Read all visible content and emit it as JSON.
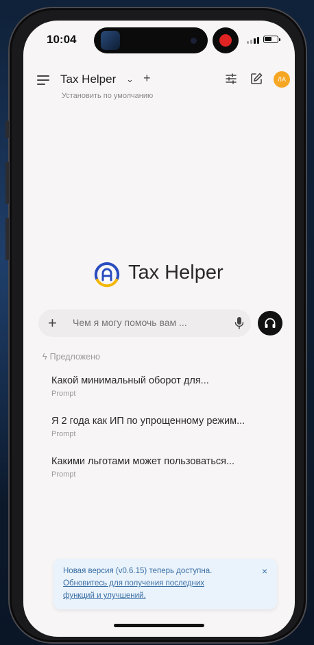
{
  "status_bar": {
    "time": "10:04"
  },
  "header": {
    "title": "Tax Helper",
    "chevron": "⌄",
    "new_model": "+",
    "set_default": "Установить по умолчанию",
    "avatar_initials": "ЛА"
  },
  "brand": {
    "name": "Tax Helper"
  },
  "chat_input": {
    "add": "+",
    "placeholder": "Чем я могу помочь вам ..."
  },
  "suggestions": {
    "heading": "Предложено",
    "items": [
      {
        "title": "Какой минимальный оборот для...",
        "subtitle": "Prompt"
      },
      {
        "title": "Я 2 года как ИП по упрощенному режим...",
        "subtitle": "Prompt"
      },
      {
        "title": "Какими льготами может пользоваться...",
        "subtitle": "Prompt"
      }
    ]
  },
  "toast": {
    "line1": "Новая версия (v0.6.15) теперь доступна.",
    "link_line1": "Обновитесь для получения последних",
    "link_line2": "функций и улучшений.",
    "close": "×"
  },
  "colors": {
    "avatar": "#f5a623",
    "logo_blue": "#2a4cbf",
    "logo_yellow": "#f2b705",
    "toast_text": "#3a6ea5",
    "screen_bg": "#f7f5f5"
  }
}
